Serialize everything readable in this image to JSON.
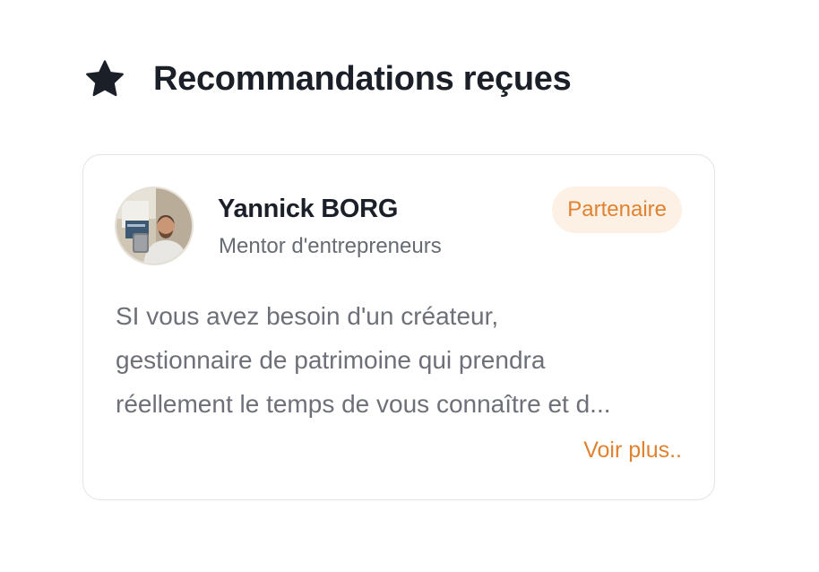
{
  "section": {
    "icon": "star-icon",
    "title": "Recommandations reçues"
  },
  "recommendation": {
    "author": {
      "name": "Yannick BORG",
      "role": "Mentor d'entrepreneurs",
      "avatar": "avatar-photo"
    },
    "badge": "Partenaire",
    "excerpt": "SI vous avez besoin d'un créateur,\ngestionnaire de patrimoine qui prendra\nréellement le temps de vous connaître et d...",
    "more_label": "Voir plus.."
  },
  "colors": {
    "accent": "#e0822f",
    "badge_bg": "#fdf0e4",
    "title": "#1b1f27",
    "muted": "#6d7078",
    "border": "#e3e4e8"
  }
}
